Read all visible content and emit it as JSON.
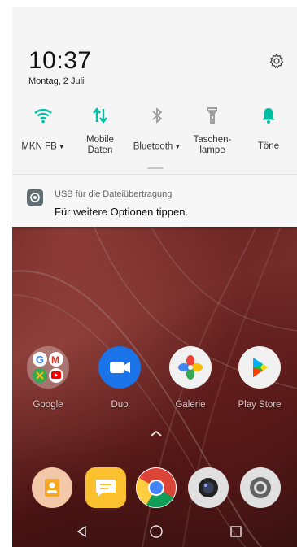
{
  "status": {
    "time": "10:37",
    "date": "Montag, 2 Juli"
  },
  "quick_tiles": [
    {
      "label": "MKN FB",
      "icon": "wifi-icon",
      "has_dropdown": true,
      "active": true
    },
    {
      "label": "Mobile\nDaten",
      "icon": "mobile-data-icon",
      "has_dropdown": false,
      "active": true
    },
    {
      "label": "Bluetooth",
      "icon": "bluetooth-icon",
      "has_dropdown": true,
      "active": false
    },
    {
      "label": "Taschen-\nlampe",
      "icon": "flashlight-icon",
      "has_dropdown": false,
      "active": false
    },
    {
      "label": "Töne",
      "icon": "bell-icon",
      "has_dropdown": false,
      "active": true
    }
  ],
  "notification": {
    "title": "USB für die Dateiübertragung",
    "body": "Für weitere Optionen tippen."
  },
  "home_apps": [
    {
      "name": "Google",
      "icon": "google-folder-icon"
    },
    {
      "name": "Duo",
      "icon": "duo-icon"
    },
    {
      "name": "Galerie",
      "icon": "gallery-icon"
    },
    {
      "name": "Play Store",
      "icon": "play-store-icon"
    }
  ],
  "dock_apps": [
    {
      "icon": "contacts-icon"
    },
    {
      "icon": "messages-icon"
    },
    {
      "icon": "chrome-icon"
    },
    {
      "icon": "camera-icon"
    },
    {
      "icon": "settings-icon"
    }
  ],
  "colors": {
    "accent": "#00bfa5",
    "inactive": "#9e9e9e",
    "shade_bg": "#f5f5f5"
  }
}
